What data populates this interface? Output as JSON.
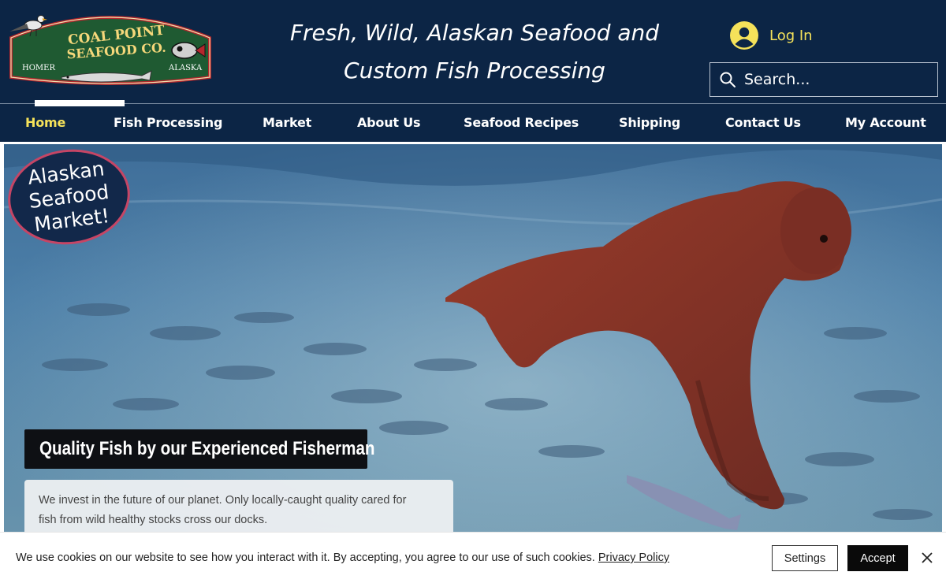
{
  "header": {
    "logo": {
      "name": "COAL POINT SEAFOOD CO.",
      "line1": "COAL POINT",
      "line2": "SEAFOOD CO.",
      "left_location": "HOMER",
      "right_location": "ALASKA"
    },
    "tagline_line1": "Fresh, Wild, Alaskan Seafood and",
    "tagline_line2": "Custom Fish Processing",
    "login_label": "Log In",
    "search_placeholder": "Search..."
  },
  "nav": {
    "items": [
      {
        "label": "Home",
        "active": true
      },
      {
        "label": "Fish Processing",
        "active": false
      },
      {
        "label": "Market",
        "active": false
      },
      {
        "label": "About Us",
        "active": false
      },
      {
        "label": "Seafood Recipes",
        "active": false
      },
      {
        "label": "Shipping",
        "active": false
      },
      {
        "label": "Contact Us",
        "active": false
      },
      {
        "label": "My Account",
        "active": false
      }
    ]
  },
  "hero": {
    "badge_line1": "Alaskan",
    "badge_line2": "Seafood",
    "badge_line3": "Market!",
    "quality_title": "Quality Fish by our Experienced Fisherman",
    "invest_line1": "We invest in the future of our planet. Only locally-caught quality cared for",
    "invest_line2": "fish from wild healthy stocks cross our docks."
  },
  "cookie": {
    "text": "We use cookies on our website to see how you interact with it. By accepting, you agree to our use of such cookies.",
    "link_label": "Privacy Policy",
    "settings_label": "Settings",
    "accept_label": "Accept"
  },
  "colors": {
    "header_bg": "#0c2545",
    "active_nav": "#f5e25a",
    "logo_green": "#1f5a32",
    "logo_red": "#b3272d",
    "badge_border": "#c64565"
  },
  "icons": {
    "avatar": "user-avatar-icon",
    "search": "search-icon",
    "close": "close-icon"
  }
}
